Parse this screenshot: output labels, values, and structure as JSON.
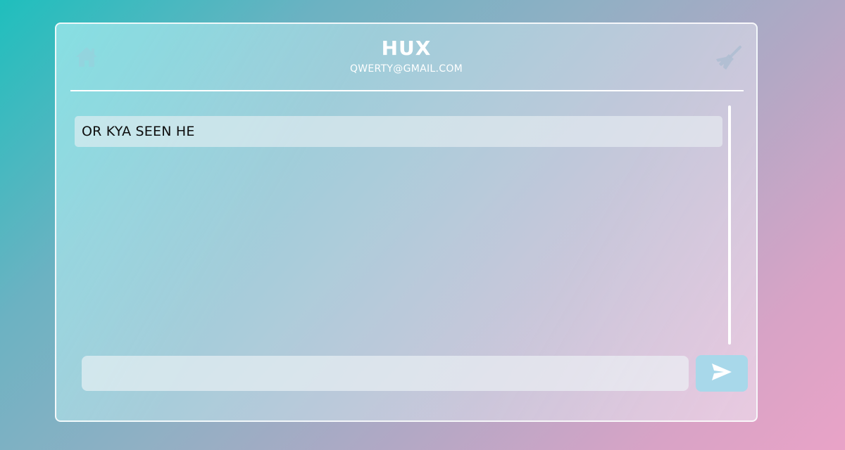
{
  "header": {
    "title": "HUX",
    "subtitle": "QWERTY@GMAIL.COM",
    "left_icon": "home-icon",
    "right_icon": "broom-icon"
  },
  "messages": [
    {
      "text": "OR KYA SEEN HE"
    }
  ],
  "composer": {
    "value": "",
    "placeholder": "",
    "send_icon": "send-icon"
  },
  "colors": {
    "accent": "#a8d8ea",
    "text": "#ffffff"
  }
}
